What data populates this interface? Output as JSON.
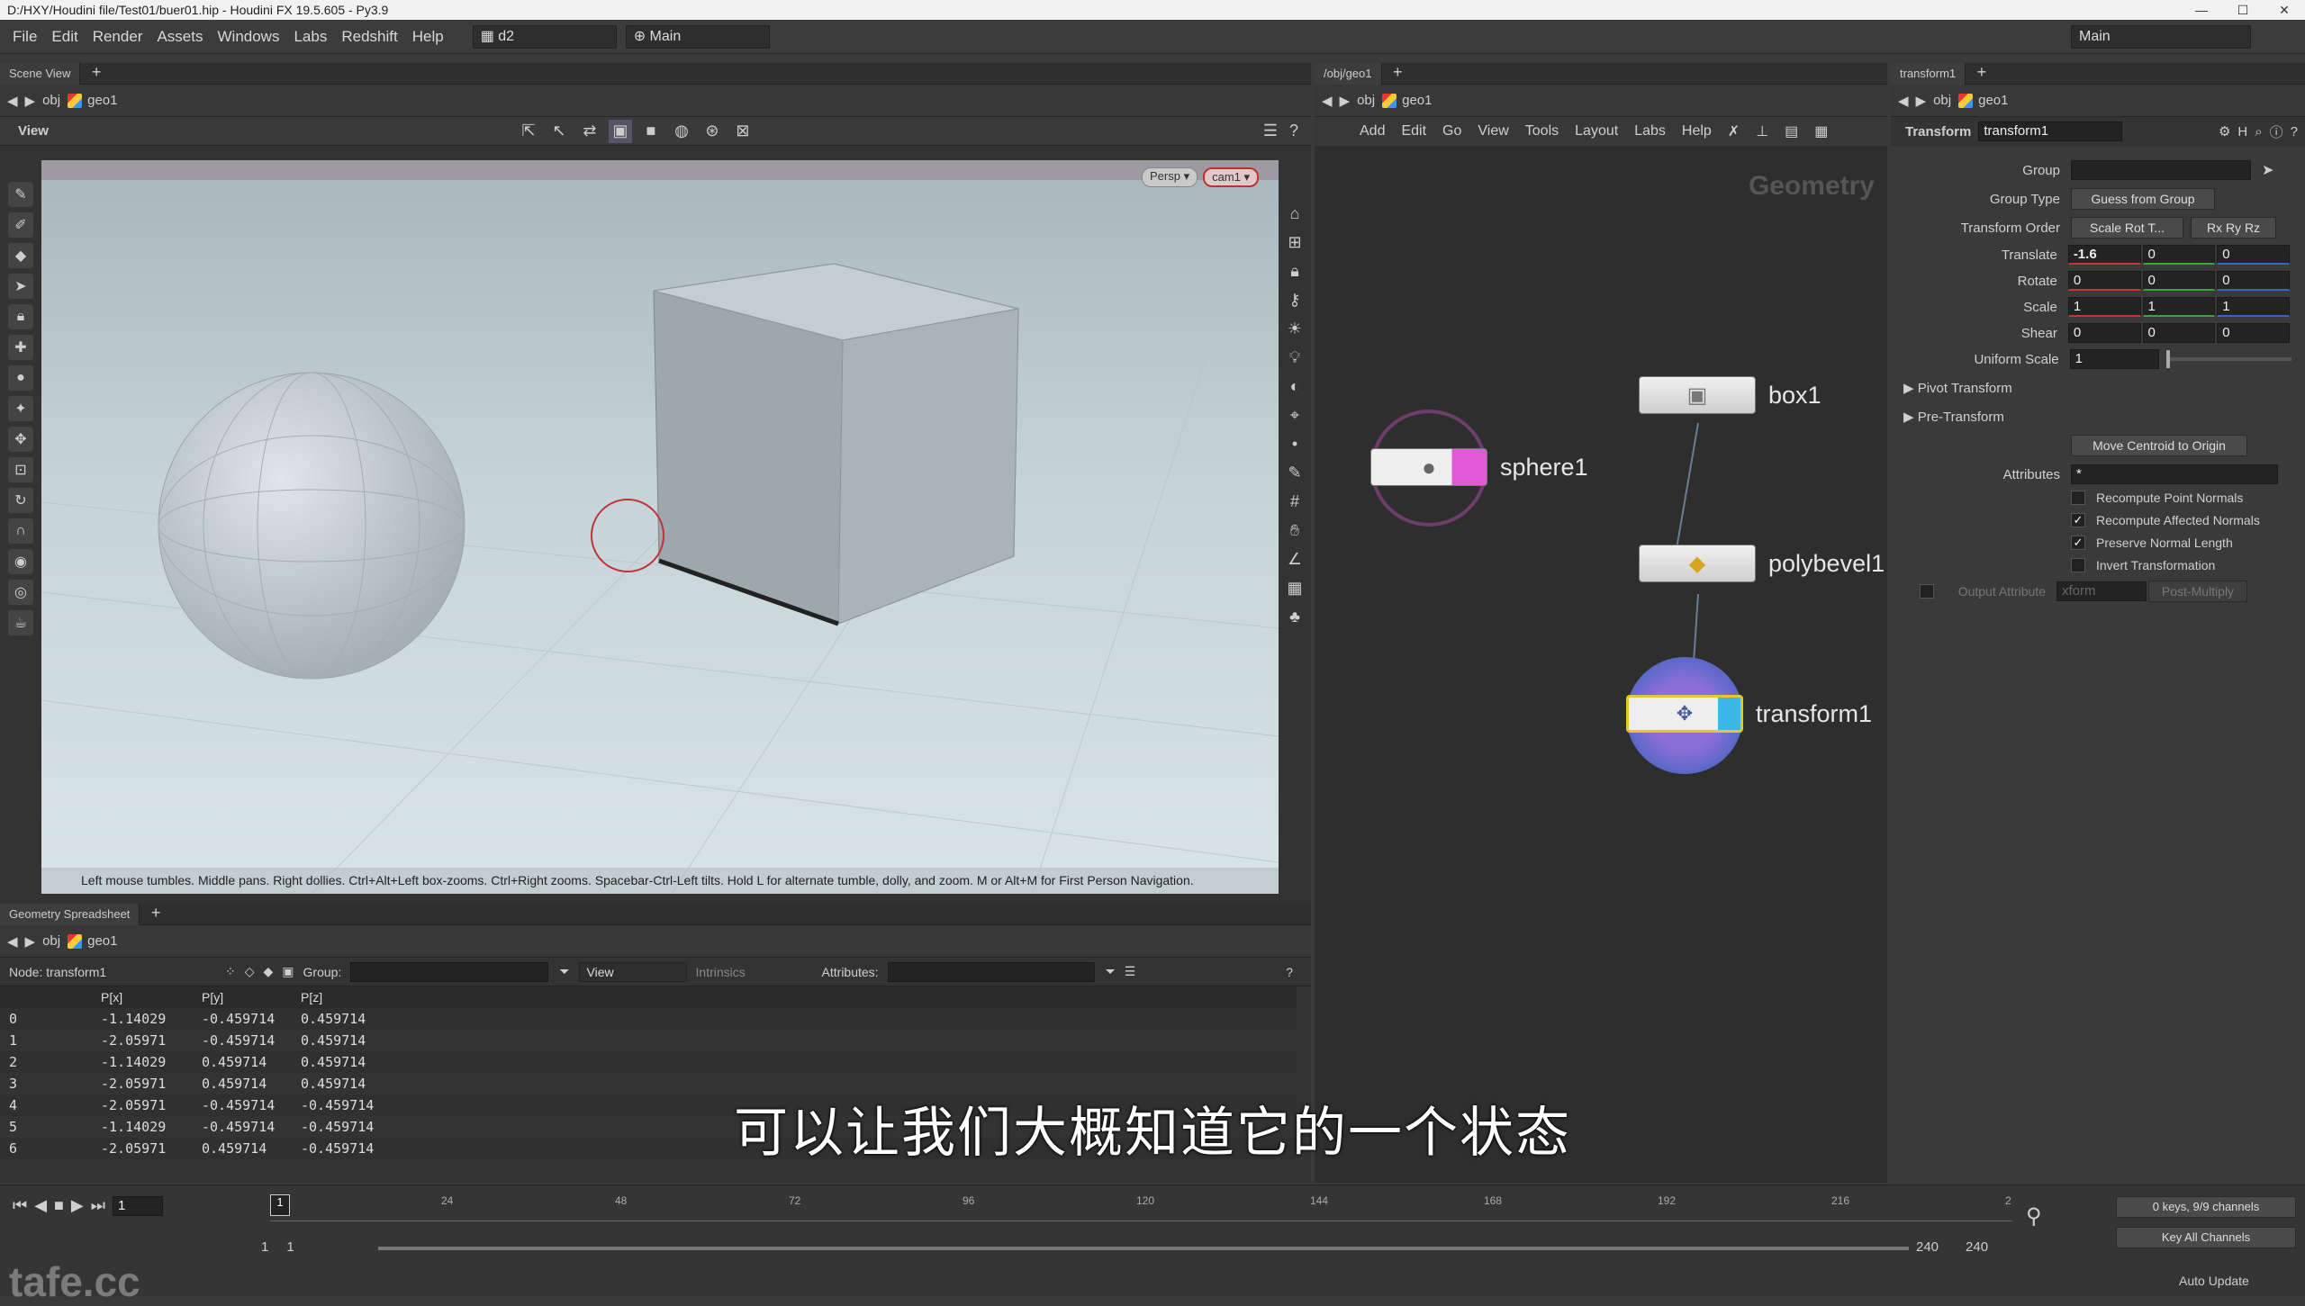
{
  "window": {
    "title": "D:/HXY/Houdini file/Test01/buer01.hip - Houdini FX 19.5.605 - Py3.9",
    "controls": [
      "—",
      "☐",
      "✕"
    ]
  },
  "menu": {
    "items": [
      "File",
      "Edit",
      "Render",
      "Assets",
      "Windows",
      "Labs",
      "Redshift",
      "Help"
    ],
    "desktop": "d2",
    "workspace": "Main",
    "right_workspace": "Main"
  },
  "scene": {
    "tab": "Scene View",
    "path_obj": "obj",
    "path_geo": "geo1",
    "view_label": "View",
    "persp": "Persp ▾",
    "cam": "cam1 ▾",
    "hint": "Left mouse tumbles. Middle pans. Right dollies. Ctrl+Alt+Left box-zooms. Ctrl+Right zooms. Spacebar-Ctrl-Left tilts. Hold L for alternate tumble, dolly, and zoom.    M or Alt+M for First Person Navigation."
  },
  "spreadsheet": {
    "tab": "Geometry Spreadsheet",
    "node_label": "Node: transform1",
    "group_label": "Group:",
    "view_label": "View",
    "intrinsics_label": "Intrinsics",
    "attributes_label": "Attributes:",
    "headers": [
      "",
      "P[x]",
      "P[y]",
      "P[z]"
    ],
    "rows": [
      [
        "0",
        "-1.14029",
        "-0.459714",
        "0.459714"
      ],
      [
        "1",
        "-2.05971",
        "-0.459714",
        "0.459714"
      ],
      [
        "2",
        "-1.14029",
        "0.459714",
        "0.459714"
      ],
      [
        "3",
        "-2.05971",
        "0.459714",
        "0.459714"
      ],
      [
        "4",
        "-2.05971",
        "-0.459714",
        "-0.459714"
      ],
      [
        "5",
        "-1.14029",
        "-0.459714",
        "-0.459714"
      ],
      [
        "6",
        "-2.05971",
        "0.459714",
        "-0.459714"
      ]
    ]
  },
  "network": {
    "tab": "/obj/geo1",
    "path_obj": "obj",
    "path_geo": "geo1",
    "menu": [
      "Add",
      "Edit",
      "Go",
      "View",
      "Tools",
      "Layout",
      "Labs",
      "Help"
    ],
    "context_label": "Geometry",
    "nodes": {
      "box": "box1",
      "sphere": "sphere1",
      "polybevel": "polybevel1",
      "transform": "transform1"
    }
  },
  "params": {
    "tab": "transform1",
    "path_obj": "obj",
    "path_geo": "geo1",
    "type": "Transform",
    "name": "transform1",
    "group": {
      "label": "Group",
      "value": ""
    },
    "group_type": {
      "label": "Group Type",
      "value": "Guess from Group"
    },
    "transform_order": {
      "label": "Transform Order",
      "value": "Scale Rot T...",
      "value2": "Rx Ry Rz"
    },
    "translate": {
      "label": "Translate",
      "x": "-1.6",
      "y": "0",
      "z": "0"
    },
    "rotate": {
      "label": "Rotate",
      "x": "0",
      "y": "0",
      "z": "0"
    },
    "scale": {
      "label": "Scale",
      "x": "1",
      "y": "1",
      "z": "1"
    },
    "shear": {
      "label": "Shear",
      "x": "0",
      "y": "0",
      "z": "0"
    },
    "uniform_scale": {
      "label": "Uniform Scale",
      "value": "1"
    },
    "pivot": "Pivot Transform",
    "pre": "Pre-Transform",
    "move_centroid": "Move Centroid to Origin",
    "attributes": {
      "label": "Attributes",
      "value": "*"
    },
    "checks": [
      {
        "label": "Recompute Point Normals",
        "checked": false
      },
      {
        "label": "Recompute Affected Normals",
        "checked": true
      },
      {
        "label": "Preserve Normal Length",
        "checked": true
      },
      {
        "label": "Invert Transformation",
        "checked": false
      }
    ],
    "output_attr": {
      "label": "Output Attribute",
      "value": "xform",
      "mult": "Post-Multiply"
    }
  },
  "timeline": {
    "ticks": [
      "24",
      "48",
      "72",
      "96",
      "120",
      "144",
      "168",
      "192",
      "216",
      "2"
    ],
    "current": "1",
    "start": "1",
    "start2": "1",
    "end": "240",
    "end2": "240",
    "keys": "0 keys, 9/9 channels",
    "key_all": "Key All Channels",
    "auto_update": "Auto Update"
  },
  "watermark": "tafe.cc",
  "subtitle": "可以让我们大概知道它的一个状态"
}
